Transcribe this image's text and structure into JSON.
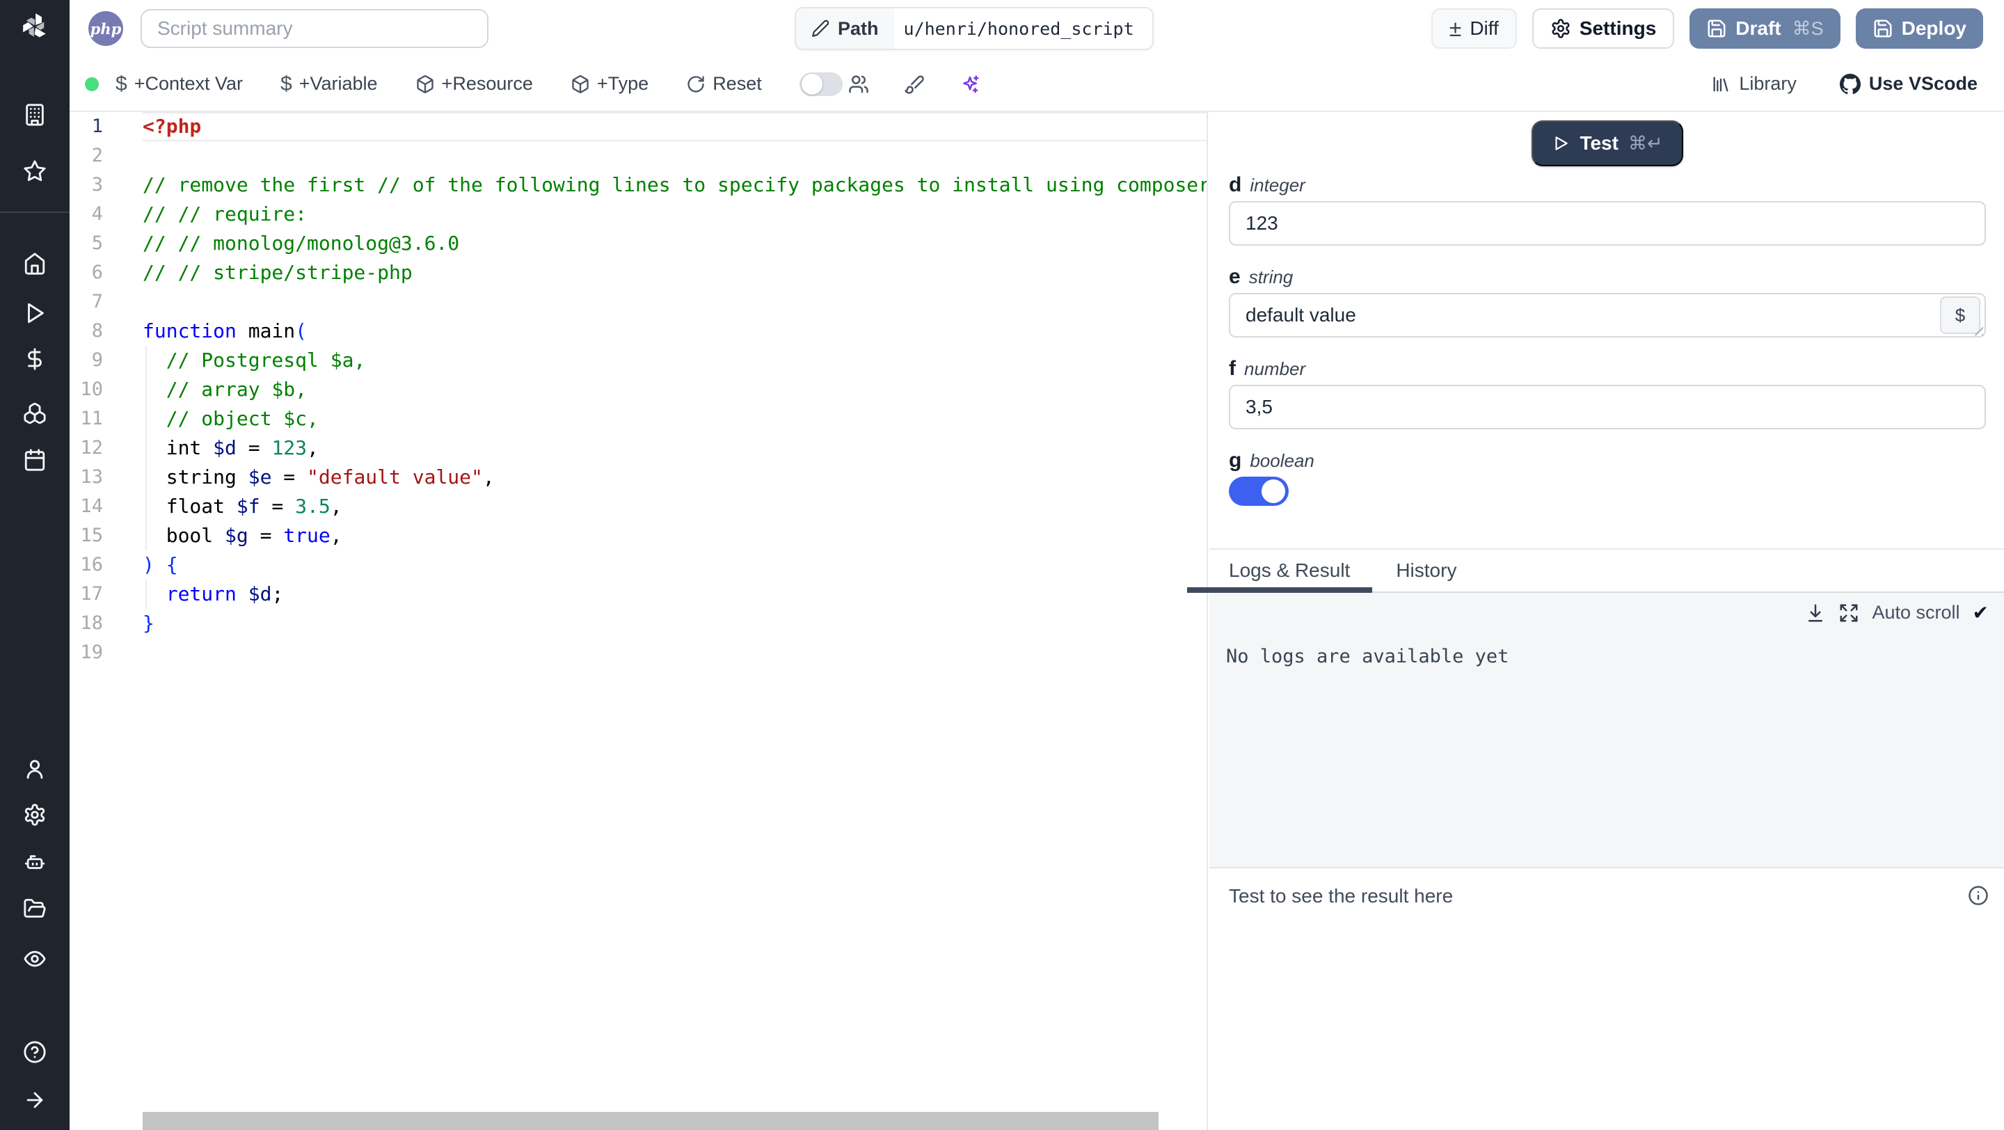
{
  "colors": {
    "accent": "#6b82a7",
    "test_btn": "#2e3b54",
    "toggle_on": "#3c61f0",
    "status_dot": "#4ade80",
    "sparkle": "#7a3bdc",
    "php_badge": "#777bb3"
  },
  "icons": {
    "plus_minus": "±",
    "check": "✔",
    "dollar": "$"
  },
  "sidebar": {
    "items": [
      "workspace",
      "favorites",
      "home",
      "runs",
      "variables",
      "resources",
      "schedules",
      "user",
      "settings",
      "workers",
      "folders",
      "audit",
      "help",
      "expand"
    ]
  },
  "header": {
    "language_badge": "php",
    "summary_placeholder": "Script summary",
    "path_label": "Path",
    "path_value": "u/henri/honored_script",
    "diff_label": "Diff",
    "settings_label": "Settings",
    "draft_label": "Draft",
    "draft_shortcut": "⌘S",
    "deploy_label": "Deploy"
  },
  "toolbar": {
    "context_var": "+Context Var",
    "variable": "+Variable",
    "resource": "+Resource",
    "type": "+Type",
    "reset": "Reset",
    "library": "Library",
    "use_vscode": "Use VScode"
  },
  "editor": {
    "lines": [
      {
        "n": 1,
        "cur": true,
        "tokens": [
          [
            "meta",
            "<?php"
          ]
        ]
      },
      {
        "n": 2,
        "tokens": []
      },
      {
        "n": 3,
        "tokens": [
          [
            "cmt",
            "// remove the first // of the following lines to specify packages to install using composer:"
          ]
        ]
      },
      {
        "n": 4,
        "tokens": [
          [
            "cmt",
            "// // require:"
          ]
        ]
      },
      {
        "n": 5,
        "tokens": [
          [
            "cmt",
            "// // monolog/monolog@3.6.0"
          ]
        ]
      },
      {
        "n": 6,
        "tokens": [
          [
            "cmt",
            "// // stripe/stripe-php"
          ]
        ]
      },
      {
        "n": 7,
        "tokens": []
      },
      {
        "n": 8,
        "tokens": [
          [
            "kw",
            "function"
          ],
          [
            "pl",
            " main"
          ],
          [
            "b1",
            "("
          ]
        ]
      },
      {
        "n": 9,
        "g": true,
        "tokens": [
          [
            "cmt",
            "  // Postgresql $a,"
          ]
        ]
      },
      {
        "n": 10,
        "g": true,
        "tokens": [
          [
            "cmt",
            "  // array $b,"
          ]
        ]
      },
      {
        "n": 11,
        "g": true,
        "tokens": [
          [
            "cmt",
            "  // object $c,"
          ]
        ]
      },
      {
        "n": 12,
        "g": true,
        "tokens": [
          [
            "pl",
            "  int "
          ],
          [
            "var",
            "$d"
          ],
          [
            "pl",
            " = "
          ],
          [
            "num",
            "123"
          ],
          [
            "pl",
            ","
          ]
        ]
      },
      {
        "n": 13,
        "g": true,
        "tokens": [
          [
            "pl",
            "  string "
          ],
          [
            "var",
            "$e"
          ],
          [
            "pl",
            " = "
          ],
          [
            "str",
            "\"default value\""
          ],
          [
            "pl",
            ","
          ]
        ]
      },
      {
        "n": 14,
        "g": true,
        "tokens": [
          [
            "pl",
            "  float "
          ],
          [
            "var",
            "$f"
          ],
          [
            "pl",
            " = "
          ],
          [
            "num",
            "3.5"
          ],
          [
            "pl",
            ","
          ]
        ]
      },
      {
        "n": 15,
        "g": true,
        "tokens": [
          [
            "pl",
            "  bool "
          ],
          [
            "var",
            "$g"
          ],
          [
            "pl",
            " = "
          ],
          [
            "kw",
            "true"
          ],
          [
            "pl",
            ","
          ]
        ]
      },
      {
        "n": 16,
        "tokens": [
          [
            "b1",
            ") {"
          ]
        ]
      },
      {
        "n": 17,
        "g": true,
        "tokens": [
          [
            "pl",
            "  "
          ],
          [
            "kw",
            "return"
          ],
          [
            "pl",
            " "
          ],
          [
            "var",
            "$d"
          ],
          [
            "pl",
            ";"
          ]
        ]
      },
      {
        "n": 18,
        "tokens": [
          [
            "b1",
            "}"
          ]
        ]
      },
      {
        "n": 19,
        "tokens": []
      }
    ]
  },
  "inspector": {
    "test_label": "Test",
    "test_shortcut": "⌘↵",
    "fields": {
      "d": {
        "name": "d",
        "type": "integer",
        "value": "123"
      },
      "e": {
        "name": "e",
        "type": "string",
        "value": "default value",
        "dollar_button": "$"
      },
      "f": {
        "name": "f",
        "type": "number",
        "value": "3,5"
      },
      "g": {
        "name": "g",
        "type": "boolean",
        "value": true
      }
    },
    "tabs": {
      "logs": "Logs & Result",
      "history": "History"
    },
    "active_tab": "Logs & Result",
    "autoscroll_label": "Auto scroll",
    "autoscroll_checked": true,
    "no_logs_text": "No logs are available yet",
    "result_placeholder": "Test to see the result here"
  }
}
